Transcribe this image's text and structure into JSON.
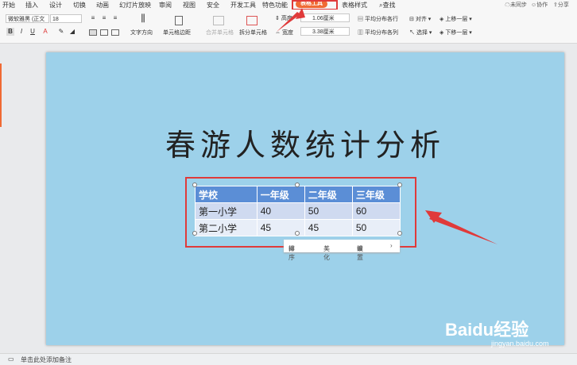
{
  "menu": {
    "tabs": [
      "开始",
      "插入",
      "设计",
      "切换",
      "动画",
      "幻灯片放映",
      "审阅",
      "视图",
      "安全",
      "开发工具",
      "特色功能"
    ],
    "active_tab": "表格工具",
    "after_tabs": [
      "表格样式"
    ],
    "search": "查找",
    "right": [
      "未同步",
      "协作",
      "分享"
    ]
  },
  "ribbon": {
    "font_name": "微软雅黑 (正文",
    "font_size": "18",
    "text_direction": "文字方向",
    "cell_margin": "单元格边距",
    "merge_cells": "合并单元格",
    "split_cells": "拆分单元格",
    "height_label": "高度",
    "height_value": "1.06厘米",
    "width_label": "宽度",
    "width_value": "3.38厘米",
    "distribute_rows": "平均分布各行",
    "distribute_cols": "平均分布各列",
    "align": "对齐",
    "select": "选择",
    "bring_forward": "上移一层",
    "send_backward": "下移一层"
  },
  "slide": {
    "title": "春游人数统计分析",
    "table": {
      "header": [
        "学校",
        "一年级",
        "二年级",
        "三年级"
      ],
      "rows": [
        [
          "第一小学",
          "40",
          "50",
          "60"
        ],
        [
          "第二小学",
          "45",
          "45",
          "50"
        ]
      ]
    },
    "floatbar": [
      "排序",
      "美化",
      "设置"
    ]
  },
  "statusbar": {
    "note": "单击此处添加备注"
  },
  "watermark": {
    "brand": "Baidu经验",
    "url": "jingyan.baidu.com"
  }
}
